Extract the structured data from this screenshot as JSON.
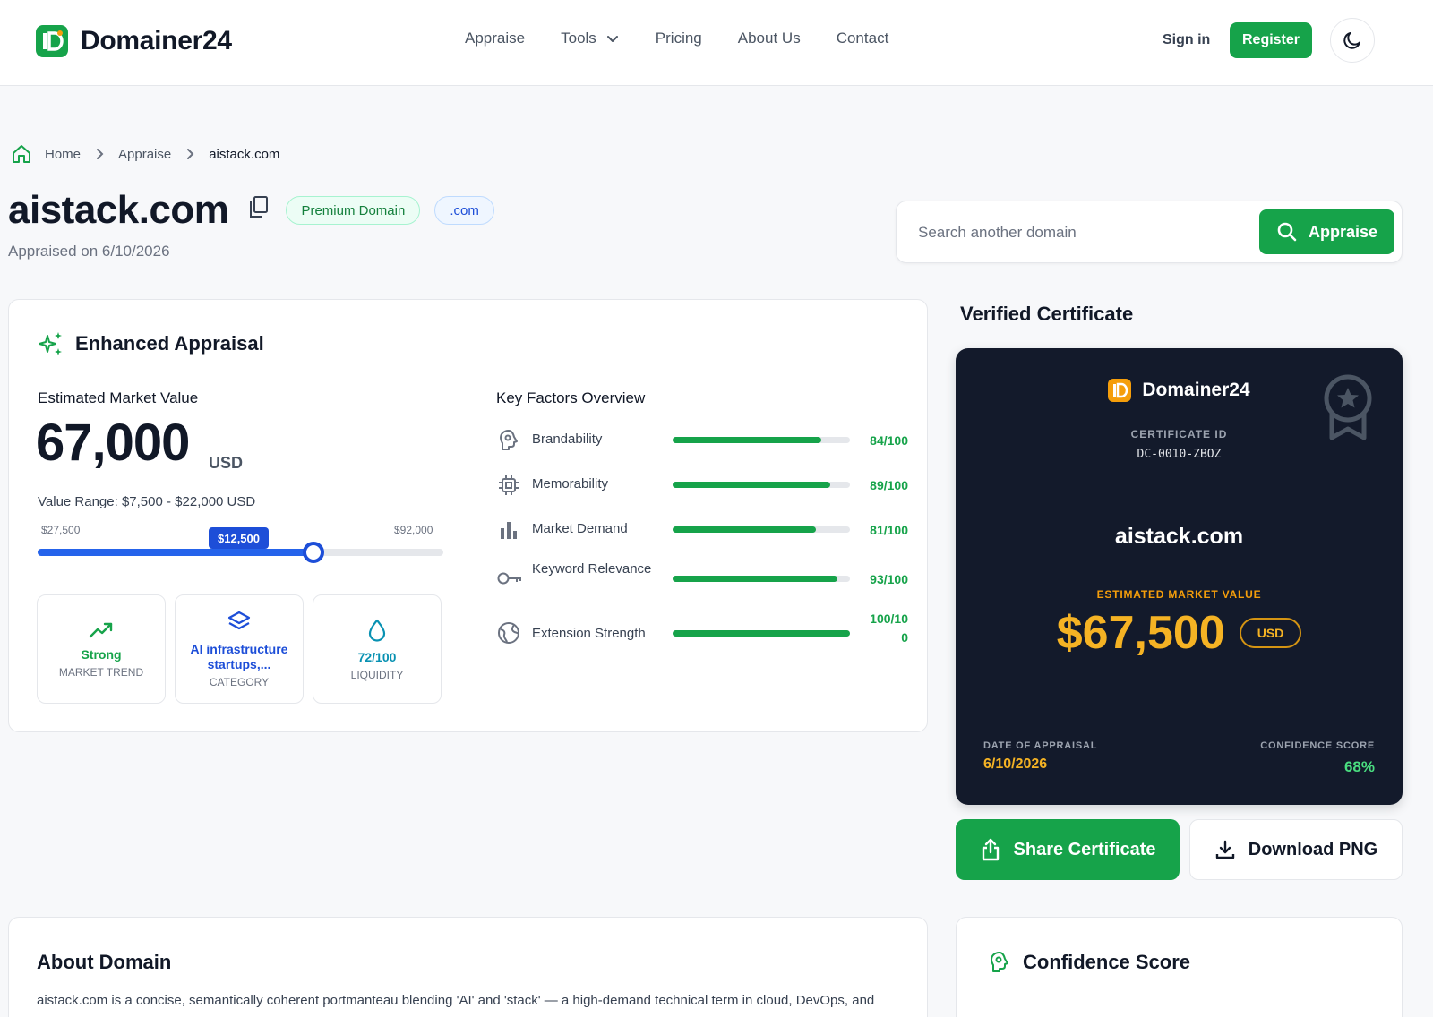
{
  "brand": {
    "name": "Domainer24"
  },
  "nav": {
    "links": [
      "Appraise",
      "Tools",
      "Pricing",
      "About Us",
      "Contact"
    ],
    "signin": "Sign in",
    "register": "Register"
  },
  "breadcrumb": {
    "home": "Home",
    "section": "Appraise",
    "current": "aistack.com"
  },
  "domain": {
    "name": "aistack.com",
    "badge_premium": "Premium Domain",
    "badge_extension": ".com",
    "appraised_on": "Appraised on 6/10/2026"
  },
  "search": {
    "placeholder": "Search another domain",
    "button": "Appraise"
  },
  "appraisal": {
    "heading": "Enhanced Appraisal",
    "emv_label": "Estimated Market Value",
    "emv_value": "67,000",
    "emv_unit": "USD",
    "value_range": "Value Range: $7,500 - $22,000 USD",
    "slider": {
      "min_label": "$27,500",
      "max_label": "$92,000",
      "current_label": "$12,500",
      "position_fraction": 0.68
    },
    "stats": [
      {
        "value": "Strong",
        "label": "MARKET TREND",
        "icon": "trending-up-icon",
        "color": "#16a34a"
      },
      {
        "value": "AI infrastructure startups,...",
        "label": "CATEGORY",
        "icon": "layers-icon",
        "color": "#1d4ed8"
      },
      {
        "value": "72/100",
        "label": "LIQUIDITY",
        "icon": "droplet-icon",
        "color": "#0891b2"
      }
    ],
    "key_factors_title": "Key Factors Overview",
    "key_factors": [
      {
        "label": "Brandability",
        "score": "84/100",
        "value": 84,
        "icon": "brain-icon"
      },
      {
        "label": "Memorability",
        "score": "89/100",
        "value": 89,
        "icon": "chip-icon"
      },
      {
        "label": "Market Demand",
        "score": "81/100",
        "value": 81,
        "icon": "bar-chart-icon"
      },
      {
        "label": "Keyword Relevance",
        "score": "93/100",
        "value": 93,
        "icon": "key-icon"
      },
      {
        "label": "Extension Strength",
        "score": "100/100",
        "value": 100,
        "icon": "globe-icon"
      }
    ]
  },
  "certificate": {
    "heading": "Verified Certificate",
    "brand": "Domainer24",
    "id_label": "CERTIFICATE ID",
    "id": "DC-0010-ZBOZ",
    "domain": "aistack.com",
    "emv_label": "ESTIMATED MARKET VALUE",
    "value": "$67,500",
    "currency": "USD",
    "date_label": "DATE OF APPRAISAL",
    "date": "6/10/2026",
    "confidence_label": "CONFIDENCE SCORE",
    "confidence": "68%"
  },
  "actions": {
    "share": "Share Certificate",
    "download": "Download PNG"
  },
  "about": {
    "title": "About Domain",
    "text": "aistack.com is a concise, semantically coherent portmanteau blending 'AI' and 'stack' — a high-demand technical term in cloud, DevOps, and"
  },
  "confidence": {
    "title": "Confidence Score"
  }
}
